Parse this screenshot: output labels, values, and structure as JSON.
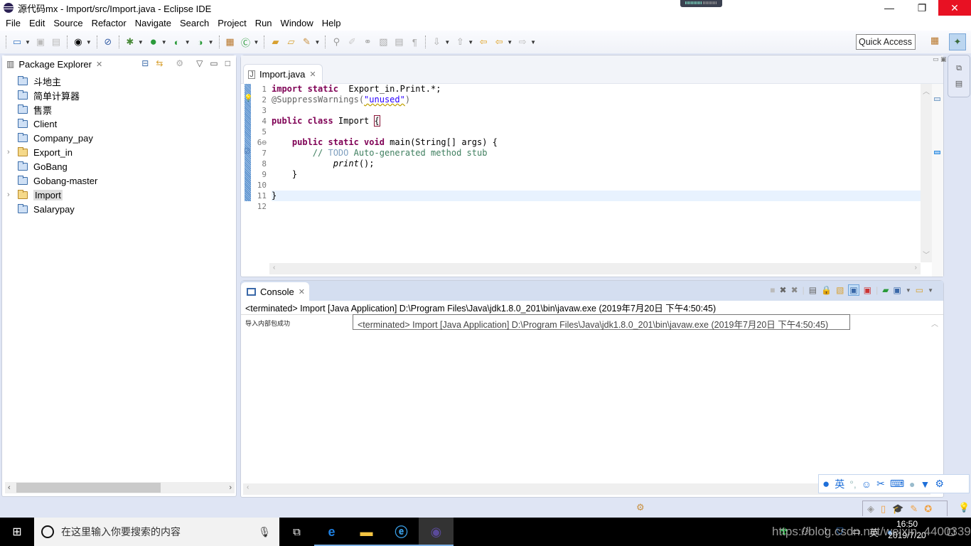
{
  "window": {
    "title": "源代码mx - Import/src/Import.java - Eclipse IDE",
    "minimize_label": "—",
    "restore_label": "❐",
    "close_label": "✕"
  },
  "menu": [
    "File",
    "Edit",
    "Source",
    "Refactor",
    "Navigate",
    "Search",
    "Project",
    "Run",
    "Window",
    "Help"
  ],
  "toolbar": {
    "quick_access": "Quick Access"
  },
  "package_explorer": {
    "title": "Package Explorer",
    "items": [
      {
        "label": "斗地主",
        "type": "folder",
        "expandable": false
      },
      {
        "label": "简单计算器",
        "type": "folder",
        "expandable": false
      },
      {
        "label": "售票",
        "type": "folder",
        "expandable": false
      },
      {
        "label": "Client",
        "type": "folder",
        "expandable": false
      },
      {
        "label": "Company_pay",
        "type": "folder",
        "expandable": false
      },
      {
        "label": "Export_in",
        "type": "project",
        "expandable": true
      },
      {
        "label": "GoBang",
        "type": "folder",
        "expandable": false
      },
      {
        "label": "Gobang-master",
        "type": "folder",
        "expandable": false
      },
      {
        "label": "Import",
        "type": "project",
        "expandable": true,
        "selected": true
      },
      {
        "label": "Salarypay",
        "type": "folder",
        "expandable": false
      }
    ]
  },
  "editor": {
    "tab": "Import.java",
    "line_numbers": [
      "1",
      "2",
      "3",
      "4",
      "5",
      "6⊖",
      "7",
      "8",
      "9",
      "10",
      "11",
      "12"
    ],
    "code": {
      "l1_kw": "import static",
      "l1_rest": "  Export_in.Print.*;",
      "l2_ann": "@SuppressWarnings(",
      "l2_str": "\"unused\"",
      "l2_end": ")",
      "l4_kw": "public class",
      "l4_rest": " Import ",
      "l4_brace": "{",
      "l6_indent": "    ",
      "l6_kw": "public static void",
      "l6_rest": " main(String[] args) {",
      "l7_indent": "        ",
      "l7_cm1": "// ",
      "l7_todo": "TODO",
      "l7_cm2": " Auto-generated method stub",
      "l8_indent": "            ",
      "l8_call": "print",
      "l8_rest": "();",
      "l9": "    }",
      "l11": "}"
    }
  },
  "console": {
    "tab": "Console",
    "description": "<terminated> Import [Java Application] D:\\Program Files\\Java\\jdk1.8.0_201\\bin\\javaw.exe (2019年7月20日 下午4:50:45)",
    "output": "导入内部包成功",
    "tooltip": "<terminated> Import [Java Application] D:\\Program Files\\Java\\jdk1.8.0_201\\bin\\javaw.exe (2019年7月20日 下午4:50:45)"
  },
  "ime": {
    "mode": "英"
  },
  "taskbar": {
    "search_placeholder": "在这里输入你要搜索的内容",
    "time": "16:50",
    "date": "2019/7/20",
    "tray_ime": "英",
    "watermark": "https://blog.csdn.net/weixin_44003391"
  }
}
